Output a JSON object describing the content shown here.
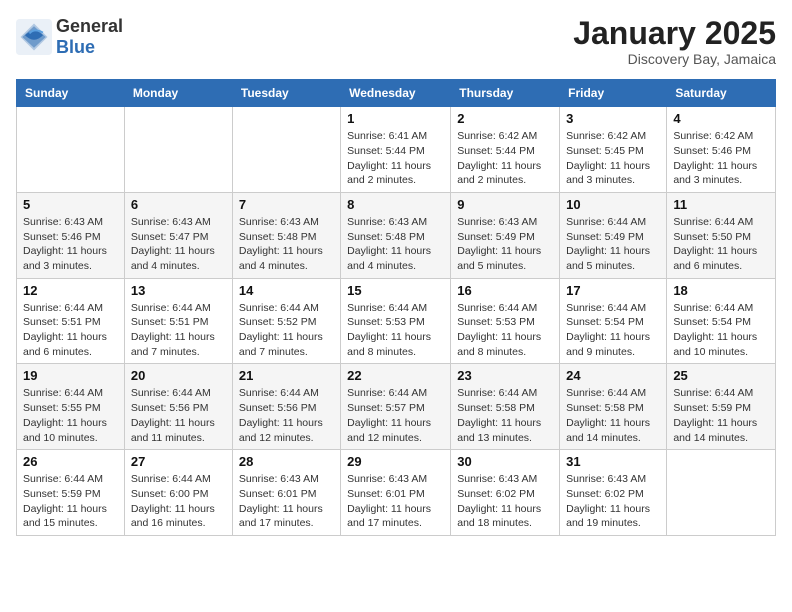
{
  "header": {
    "logo_general": "General",
    "logo_blue": "Blue",
    "month": "January 2025",
    "location": "Discovery Bay, Jamaica"
  },
  "days_of_week": [
    "Sunday",
    "Monday",
    "Tuesday",
    "Wednesday",
    "Thursday",
    "Friday",
    "Saturday"
  ],
  "weeks": [
    [
      {
        "day": "",
        "info": ""
      },
      {
        "day": "",
        "info": ""
      },
      {
        "day": "",
        "info": ""
      },
      {
        "day": "1",
        "info": "Sunrise: 6:41 AM\nSunset: 5:44 PM\nDaylight: 11 hours and 2 minutes."
      },
      {
        "day": "2",
        "info": "Sunrise: 6:42 AM\nSunset: 5:44 PM\nDaylight: 11 hours and 2 minutes."
      },
      {
        "day": "3",
        "info": "Sunrise: 6:42 AM\nSunset: 5:45 PM\nDaylight: 11 hours and 3 minutes."
      },
      {
        "day": "4",
        "info": "Sunrise: 6:42 AM\nSunset: 5:46 PM\nDaylight: 11 hours and 3 minutes."
      }
    ],
    [
      {
        "day": "5",
        "info": "Sunrise: 6:43 AM\nSunset: 5:46 PM\nDaylight: 11 hours and 3 minutes."
      },
      {
        "day": "6",
        "info": "Sunrise: 6:43 AM\nSunset: 5:47 PM\nDaylight: 11 hours and 4 minutes."
      },
      {
        "day": "7",
        "info": "Sunrise: 6:43 AM\nSunset: 5:48 PM\nDaylight: 11 hours and 4 minutes."
      },
      {
        "day": "8",
        "info": "Sunrise: 6:43 AM\nSunset: 5:48 PM\nDaylight: 11 hours and 4 minutes."
      },
      {
        "day": "9",
        "info": "Sunrise: 6:43 AM\nSunset: 5:49 PM\nDaylight: 11 hours and 5 minutes."
      },
      {
        "day": "10",
        "info": "Sunrise: 6:44 AM\nSunset: 5:49 PM\nDaylight: 11 hours and 5 minutes."
      },
      {
        "day": "11",
        "info": "Sunrise: 6:44 AM\nSunset: 5:50 PM\nDaylight: 11 hours and 6 minutes."
      }
    ],
    [
      {
        "day": "12",
        "info": "Sunrise: 6:44 AM\nSunset: 5:51 PM\nDaylight: 11 hours and 6 minutes."
      },
      {
        "day": "13",
        "info": "Sunrise: 6:44 AM\nSunset: 5:51 PM\nDaylight: 11 hours and 7 minutes."
      },
      {
        "day": "14",
        "info": "Sunrise: 6:44 AM\nSunset: 5:52 PM\nDaylight: 11 hours and 7 minutes."
      },
      {
        "day": "15",
        "info": "Sunrise: 6:44 AM\nSunset: 5:53 PM\nDaylight: 11 hours and 8 minutes."
      },
      {
        "day": "16",
        "info": "Sunrise: 6:44 AM\nSunset: 5:53 PM\nDaylight: 11 hours and 8 minutes."
      },
      {
        "day": "17",
        "info": "Sunrise: 6:44 AM\nSunset: 5:54 PM\nDaylight: 11 hours and 9 minutes."
      },
      {
        "day": "18",
        "info": "Sunrise: 6:44 AM\nSunset: 5:54 PM\nDaylight: 11 hours and 10 minutes."
      }
    ],
    [
      {
        "day": "19",
        "info": "Sunrise: 6:44 AM\nSunset: 5:55 PM\nDaylight: 11 hours and 10 minutes."
      },
      {
        "day": "20",
        "info": "Sunrise: 6:44 AM\nSunset: 5:56 PM\nDaylight: 11 hours and 11 minutes."
      },
      {
        "day": "21",
        "info": "Sunrise: 6:44 AM\nSunset: 5:56 PM\nDaylight: 11 hours and 12 minutes."
      },
      {
        "day": "22",
        "info": "Sunrise: 6:44 AM\nSunset: 5:57 PM\nDaylight: 11 hours and 12 minutes."
      },
      {
        "day": "23",
        "info": "Sunrise: 6:44 AM\nSunset: 5:58 PM\nDaylight: 11 hours and 13 minutes."
      },
      {
        "day": "24",
        "info": "Sunrise: 6:44 AM\nSunset: 5:58 PM\nDaylight: 11 hours and 14 minutes."
      },
      {
        "day": "25",
        "info": "Sunrise: 6:44 AM\nSunset: 5:59 PM\nDaylight: 11 hours and 14 minutes."
      }
    ],
    [
      {
        "day": "26",
        "info": "Sunrise: 6:44 AM\nSunset: 5:59 PM\nDaylight: 11 hours and 15 minutes."
      },
      {
        "day": "27",
        "info": "Sunrise: 6:44 AM\nSunset: 6:00 PM\nDaylight: 11 hours and 16 minutes."
      },
      {
        "day": "28",
        "info": "Sunrise: 6:43 AM\nSunset: 6:01 PM\nDaylight: 11 hours and 17 minutes."
      },
      {
        "day": "29",
        "info": "Sunrise: 6:43 AM\nSunset: 6:01 PM\nDaylight: 11 hours and 17 minutes."
      },
      {
        "day": "30",
        "info": "Sunrise: 6:43 AM\nSunset: 6:02 PM\nDaylight: 11 hours and 18 minutes."
      },
      {
        "day": "31",
        "info": "Sunrise: 6:43 AM\nSunset: 6:02 PM\nDaylight: 11 hours and 19 minutes."
      },
      {
        "day": "",
        "info": ""
      }
    ]
  ]
}
